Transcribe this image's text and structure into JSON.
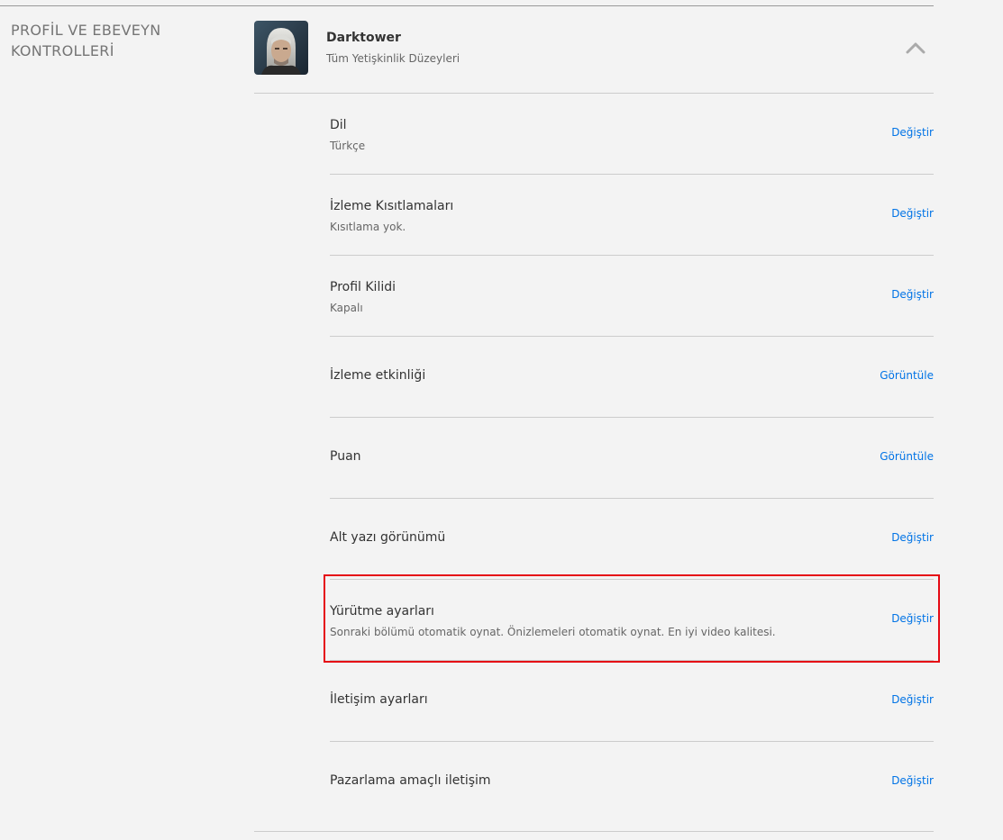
{
  "section": {
    "title": "PROFİL VE EBEVEYN KONTROLLERİ"
  },
  "profile": {
    "name": "Darktower",
    "maturity": "Tüm Yetişkinlik Düzeyleri",
    "avatar_icon": "avatar-icon",
    "collapse_icon": "chevron-up-icon"
  },
  "rows": [
    {
      "title": "Dil",
      "subtitle": "Türkçe",
      "action": "Değiştir"
    },
    {
      "title": "İzleme Kısıtlamaları",
      "subtitle": "Kısıtlama yok.",
      "action": "Değiştir"
    },
    {
      "title": "Profil Kilidi",
      "subtitle": "Kapalı",
      "action": "Değiştir"
    },
    {
      "title": "İzleme etkinliği",
      "subtitle": "",
      "action": "Görüntüle"
    },
    {
      "title": "Puan",
      "subtitle": "",
      "action": "Görüntüle"
    },
    {
      "title": "Alt yazı görünümü",
      "subtitle": "",
      "action": "Değiştir"
    },
    {
      "title": "Yürütme ayarları",
      "subtitle": "Sonraki bölümü otomatik oynat. Önizlemeleri otomatik oynat. En iyi video kalitesi.",
      "action": "Değiştir"
    },
    {
      "title": "İletişim ayarları",
      "subtitle": "",
      "action": "Değiştir"
    },
    {
      "title": "Pazarlama amaçlı iletişim",
      "subtitle": "",
      "action": "Değiştir"
    }
  ],
  "colors": {
    "link": "#0073e6",
    "highlight": "#e50914",
    "background": "#f3f3f3"
  }
}
